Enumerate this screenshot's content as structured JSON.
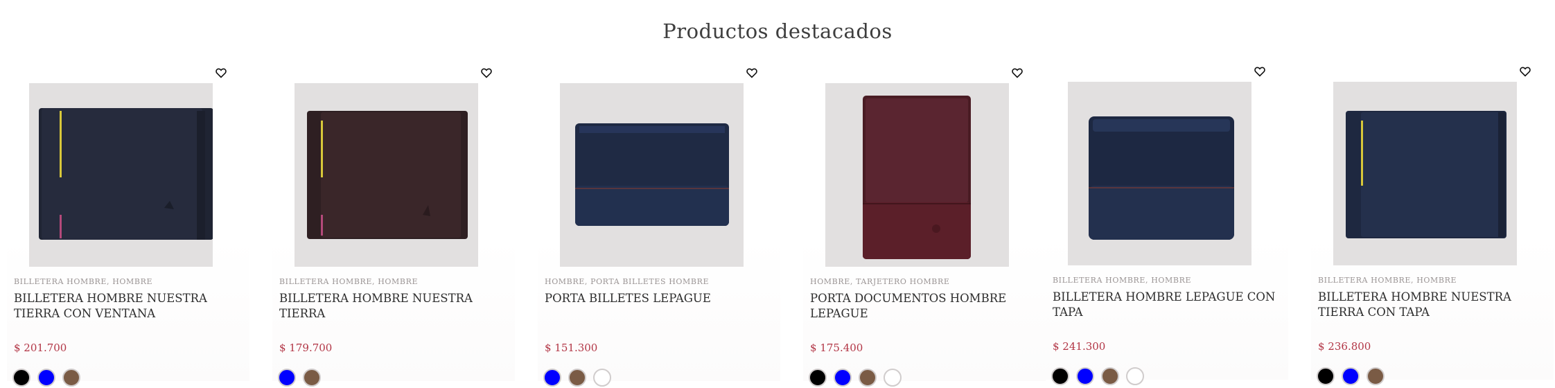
{
  "section": {
    "title": "Productos destacados"
  },
  "colors": {
    "price": "#b23545",
    "swatch_black": "#000000",
    "swatch_blue": "#0000ff",
    "swatch_brown": "#7a5b45",
    "swatch_white": "#ffffff"
  },
  "products": [
    {
      "categories": "BILLETERA HOMBRE, HOMBRE",
      "name": "BILLETERA HOMBRE NUESTRA TIERRA CON VENTANA",
      "price": "$ 201.700",
      "image_icon": "wallet-navy-yellow-stripe",
      "swatches": [
        "black",
        "blue",
        "brown"
      ]
    },
    {
      "categories": "BILLETERA HOMBRE, HOMBRE",
      "name": "BILLETERA HOMBRE NUESTRA TIERRA",
      "price": "$ 179.700",
      "image_icon": "wallet-brown-yellow-stripe",
      "swatches": [
        "blue",
        "brown"
      ]
    },
    {
      "categories": "HOMBRE, PORTA BILLETES HOMBRE",
      "name": "PORTA BILLETES LEPAGUE",
      "price": "$ 151.300",
      "image_icon": "money-clip-navy",
      "swatches": [
        "blue",
        "brown",
        "white"
      ]
    },
    {
      "categories": "HOMBRE, TARJETERO HOMBRE",
      "name": "PORTA DOCUMENTOS HOMBRE LEPAGUE",
      "price": "$ 175.400",
      "image_icon": "document-holder-burgundy",
      "swatches": [
        "black",
        "blue",
        "brown",
        "white"
      ]
    },
    {
      "categories": "BILLETERA HOMBRE, HOMBRE",
      "name": "BILLETERA HOMBRE LEPAGUE CON TAPA",
      "price": "$ 241.300",
      "image_icon": "wallet-navy-flap",
      "swatches": [
        "black",
        "blue",
        "brown",
        "white"
      ]
    },
    {
      "categories": "BILLETERA HOMBRE, HOMBRE",
      "name": "BILLETERA HOMBRE NUESTRA TIERRA CON TAPA",
      "price": "$ 236.800",
      "image_icon": "wallet-navy-yellow-stripe",
      "swatches": [
        "black",
        "blue",
        "brown"
      ]
    }
  ]
}
